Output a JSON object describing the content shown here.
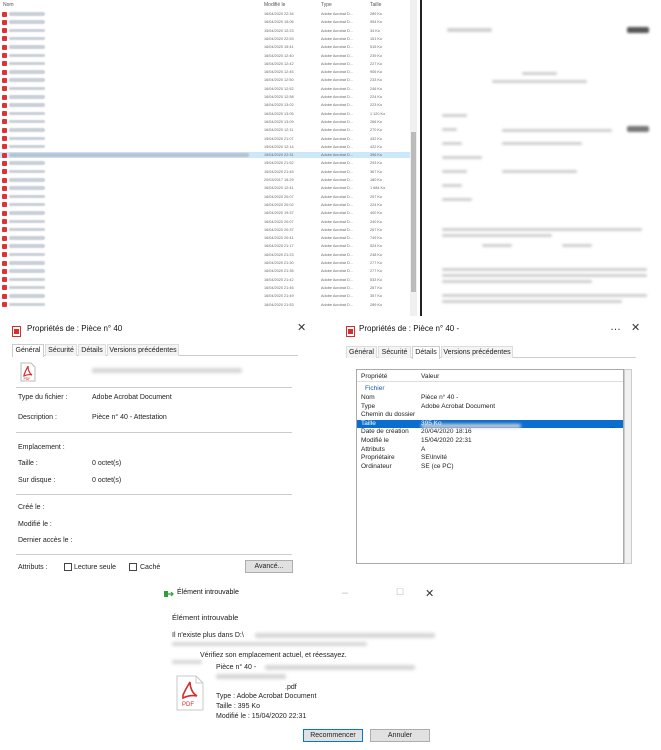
{
  "explorer": {
    "columns": {
      "name": "Nom",
      "modified": "Modifié le",
      "type": "Type",
      "size": "Taille"
    },
    "rows": [
      {
        "date": "16/04/2020 22:34",
        "type": "Adobe Acrobat D...",
        "size": "289 Ko"
      },
      {
        "date": "16/04/2020 15:06",
        "type": "Adobe Acrobat D...",
        "size": "954 Ko"
      },
      {
        "date": "15/04/2020 12:23",
        "type": "Adobe Acrobat D...",
        "size": "34 Ko"
      },
      {
        "date": "16/04/2020 22:53",
        "type": "Adobe Acrobat D...",
        "size": "151 Ko"
      },
      {
        "date": "16/04/2020 15:41",
        "type": "Adobe Acrobat D...",
        "size": "515 Ko"
      },
      {
        "date": "16/04/2020 12:40",
        "type": "Adobe Acrobat D...",
        "size": "239 Ko"
      },
      {
        "date": "16/04/2020 12:42",
        "type": "Adobe Acrobat D...",
        "size": "227 Ko"
      },
      {
        "date": "16/04/2020 12:45",
        "type": "Adobe Acrobat D...",
        "size": "906 Ko"
      },
      {
        "date": "16/04/2020 12:50",
        "type": "Adobe Acrobat D...",
        "size": "233 Ko"
      },
      {
        "date": "16/04/2020 12:52",
        "type": "Adobe Acrobat D...",
        "size": "246 Ko"
      },
      {
        "date": "16/04/2020 12:58",
        "type": "Adobe Acrobat D...",
        "size": "224 Ko"
      },
      {
        "date": "16/04/2020 13:02",
        "type": "Adobe Acrobat D...",
        "size": "223 Ko"
      },
      {
        "date": "16/04/2020 13:05",
        "type": "Adobe Acrobat D...",
        "size": "1 120 Ko"
      },
      {
        "date": "16/04/2020 13:09",
        "type": "Adobe Acrobat D...",
        "size": "266 Ko"
      },
      {
        "date": "16/04/2020 12:11",
        "type": "Adobe Acrobat D...",
        "size": "270 Ko"
      },
      {
        "date": "15/04/2020 21:07",
        "type": "Adobe Acrobat D...",
        "size": "432 Ko"
      },
      {
        "date": "15/04/2020 12:14",
        "type": "Adobe Acrobat D...",
        "size": "422 Ko"
      },
      {
        "date": "15/04/2020 22:31",
        "type": "Adobe Acrobat D...",
        "size": "396 Ko"
      },
      {
        "date": "15/04/2020 21:52",
        "type": "Adobe Acrobat D...",
        "size": "293 Ko"
      },
      {
        "date": "15/04/2020 21:45",
        "type": "Adobe Acrobat D...",
        "size": "367 Ko"
      },
      {
        "date": "20/03/2017 15:29",
        "type": "Adobe Acrobat D...",
        "size": "180 Ko"
      },
      {
        "date": "16/04/2020 12:41",
        "type": "Adobe Acrobat D...",
        "size": "1 684 Ko"
      },
      {
        "date": "16/04/2020 20:07",
        "type": "Adobe Acrobat D...",
        "size": "257 Ko"
      },
      {
        "date": "16/04/2020 20:02",
        "type": "Adobe Acrobat D...",
        "size": "224 Ko"
      },
      {
        "date": "16/04/2020 19:37",
        "type": "Adobe Acrobat D...",
        "size": "400 Ko"
      },
      {
        "date": "16/04/2020 20:07",
        "type": "Adobe Acrobat D...",
        "size": "240 Ko"
      },
      {
        "date": "16/04/2020 20:37",
        "type": "Adobe Acrobat D...",
        "size": "267 Ko"
      },
      {
        "date": "16/04/2020 20:41",
        "type": "Adobe Acrobat D...",
        "size": "749 Ko"
      },
      {
        "date": "16/04/2020 21:17",
        "type": "Adobe Acrobat D...",
        "size": "524 Ko"
      },
      {
        "date": "16/04/2020 21:23",
        "type": "Adobe Acrobat D...",
        "size": "248 Ko"
      },
      {
        "date": "16/04/2020 21:30",
        "type": "Adobe Acrobat D...",
        "size": "277 Ko"
      },
      {
        "date": "16/04/2020 21:35",
        "type": "Adobe Acrobat D...",
        "size": "277 Ko"
      },
      {
        "date": "16/04/2020 21:42",
        "type": "Adobe Acrobat D...",
        "size": "533 Ko"
      },
      {
        "date": "16/04/2020 21:46",
        "type": "Adobe Acrobat D...",
        "size": "287 Ko"
      },
      {
        "date": "16/04/2020 21:49",
        "type": "Adobe Acrobat D...",
        "size": "357 Ko"
      },
      {
        "date": "16/04/2020 21:53",
        "type": "Adobe Acrobat D...",
        "size": "289 Ko"
      }
    ]
  },
  "props_general": {
    "title": "Propriétés de : Pièce n° 40",
    "tabs": [
      "Général",
      "Sécurité",
      "Détails",
      "Versions précédentes"
    ],
    "type_label": "Type du fichier :",
    "type_value": "Adobe Acrobat Document",
    "desc_label": "Description :",
    "desc_value": "Pièce n° 40 - Attestation",
    "location_label": "Emplacement :",
    "size_label": "Taille :",
    "size_value": "0 octet(s)",
    "disk_label": "Sur disque :",
    "disk_value": "0 octet(s)",
    "created_label": "Créé le :",
    "modified_label": "Modifié le :",
    "accessed_label": "Dernier accès le :",
    "attrs_label": "Attributs :",
    "readonly_label": "Lecture seule",
    "hidden_label": "Caché",
    "advanced_button": "Avancé..."
  },
  "props_details": {
    "title": "Propriétés de : Pièce n° 40 -",
    "tabs": [
      "Général",
      "Sécurité",
      "Détails",
      "Versions précédentes"
    ],
    "header_property": "Propriété",
    "header_value": "Valeur",
    "group": "Fichier",
    "rows": [
      {
        "p": "Nom",
        "v": "Pièce n° 40 -"
      },
      {
        "p": "Type",
        "v": "Adobe Acrobat Document"
      },
      {
        "p": "Chemin du dossier",
        "v": ""
      },
      {
        "p": "Taille",
        "v": "395 Ko"
      },
      {
        "p": "Date de création",
        "v": "20/04/2020 18:16"
      },
      {
        "p": "Modifié le",
        "v": "15/04/2020 22:31"
      },
      {
        "p": "Attributs",
        "v": "A"
      },
      {
        "p": "Propriétaire",
        "v": "SE\\Invité"
      },
      {
        "p": "Ordinateur",
        "v": "SE (ce PC)"
      }
    ],
    "path_ellipsis": "...",
    "minimize": "…",
    "close": "✕"
  },
  "notfound": {
    "title": "Élément introuvable",
    "heading": "Élément introuvable",
    "line1": "Il n'existe plus dans D:\\",
    "line2": "Vérifiez son emplacement actuel, et réessayez.",
    "file_name": "Pièce n° 40 -",
    "file_ext": ".pdf",
    "file_type": "Type : Adobe Acrobat Document",
    "file_size": "Taille : 395 Ko",
    "file_modified": "Modifié le : 15/04/2020 22:31",
    "retry_button": "Recommencer",
    "cancel_button": "Annuler",
    "icon_label": "PDF"
  },
  "colors": {
    "selection": "#0a6ed1",
    "pdf_red": "#d32f2f",
    "row_select": "#cde7fb"
  }
}
